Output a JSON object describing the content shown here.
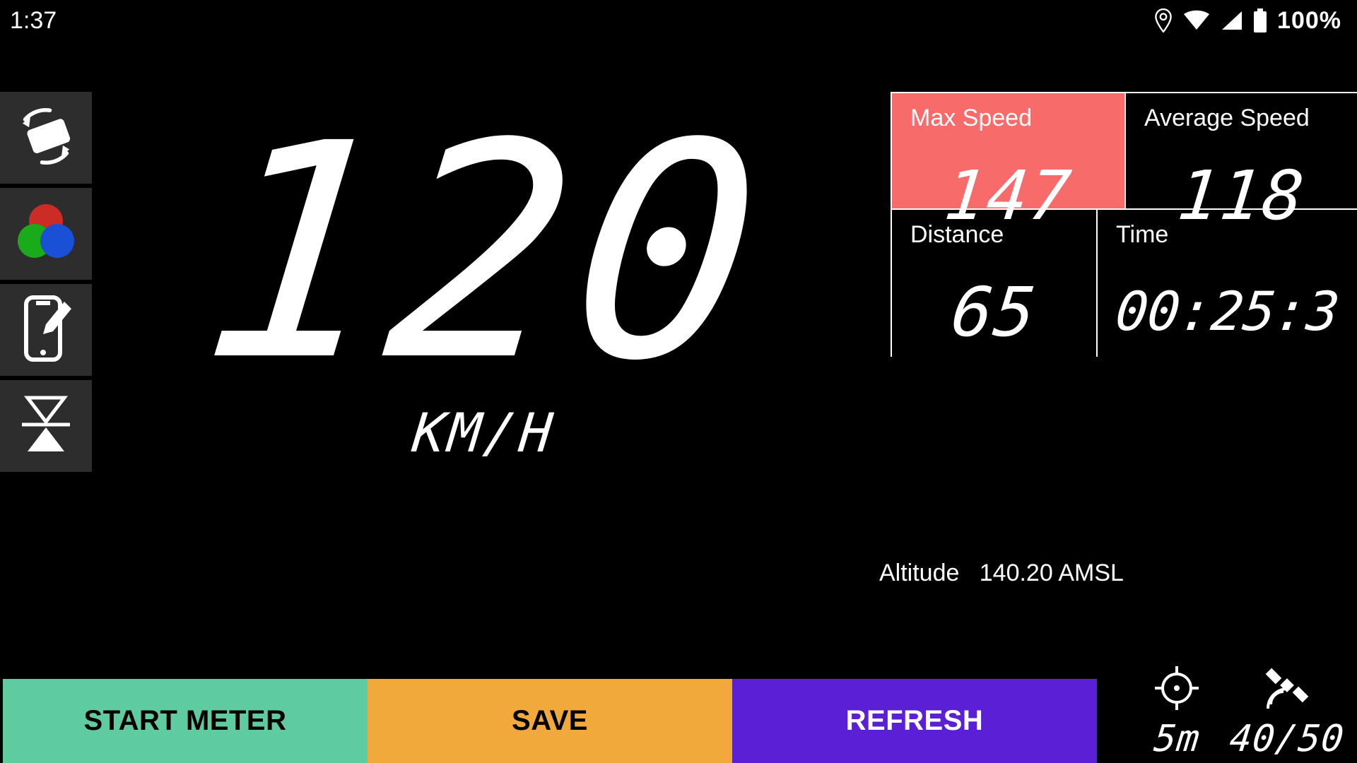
{
  "status": {
    "clock": "1:37",
    "battery_pct": "100%"
  },
  "speed": {
    "value": "120",
    "unit": "KM/H"
  },
  "stats": {
    "max_speed": {
      "label": "Max Speed",
      "value": "147"
    },
    "avg_speed": {
      "label": "Average Speed",
      "value": "118"
    },
    "distance": {
      "label": "Distance",
      "value": "65"
    },
    "time": {
      "label": "Time",
      "value": "00:25:3"
    }
  },
  "altitude": {
    "label": "Altitude",
    "value": "140.20 AMSL"
  },
  "buttons": {
    "start": "START METER",
    "save": "SAVE",
    "refresh": "REFRESH"
  },
  "gps": {
    "accuracy": "5m",
    "satellites": "40/50"
  },
  "colors": {
    "max_speed_bg": "#f76b6b",
    "btn_start": "#5ecba1",
    "btn_save": "#f2a93b",
    "btn_refresh": "#5b1fd6"
  }
}
